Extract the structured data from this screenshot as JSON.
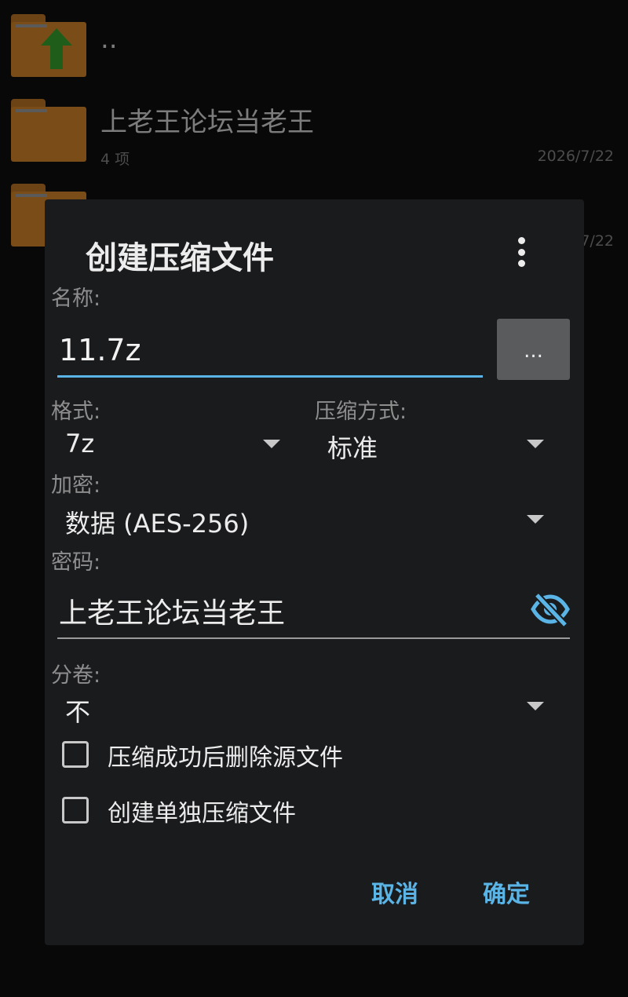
{
  "file_list": {
    "items": [
      {
        "name": "..",
        "icon": "folder-up-icon"
      },
      {
        "name": "上老王论坛当老王",
        "sub": "4 项",
        "date": "2026/7/22",
        "icon": "folder-icon"
      },
      {
        "name": "",
        "date": "7/22",
        "icon": "folder-icon"
      }
    ]
  },
  "dialog": {
    "title": "创建压缩文件",
    "name_label": "名称:",
    "name_value": "11.7z",
    "browse_label": "...",
    "format_label": "格式:",
    "format_value": "7z",
    "method_label": "压缩方式:",
    "method_value": "标准",
    "encrypt_label": "加密:",
    "encrypt_value": "数据 (AES-256)",
    "password_label": "密码:",
    "password_value": "上老王论坛当老王",
    "split_label": "分卷:",
    "split_value": "不",
    "checkbox1_label": "压缩成功后删除源文件",
    "checkbox2_label": "创建单独压缩文件",
    "cancel_label": "取消",
    "ok_label": "确定"
  },
  "colors": {
    "accent": "#5ab4e6",
    "dialog_bg": "#1a1b1d",
    "folder": "#7a4c17"
  }
}
